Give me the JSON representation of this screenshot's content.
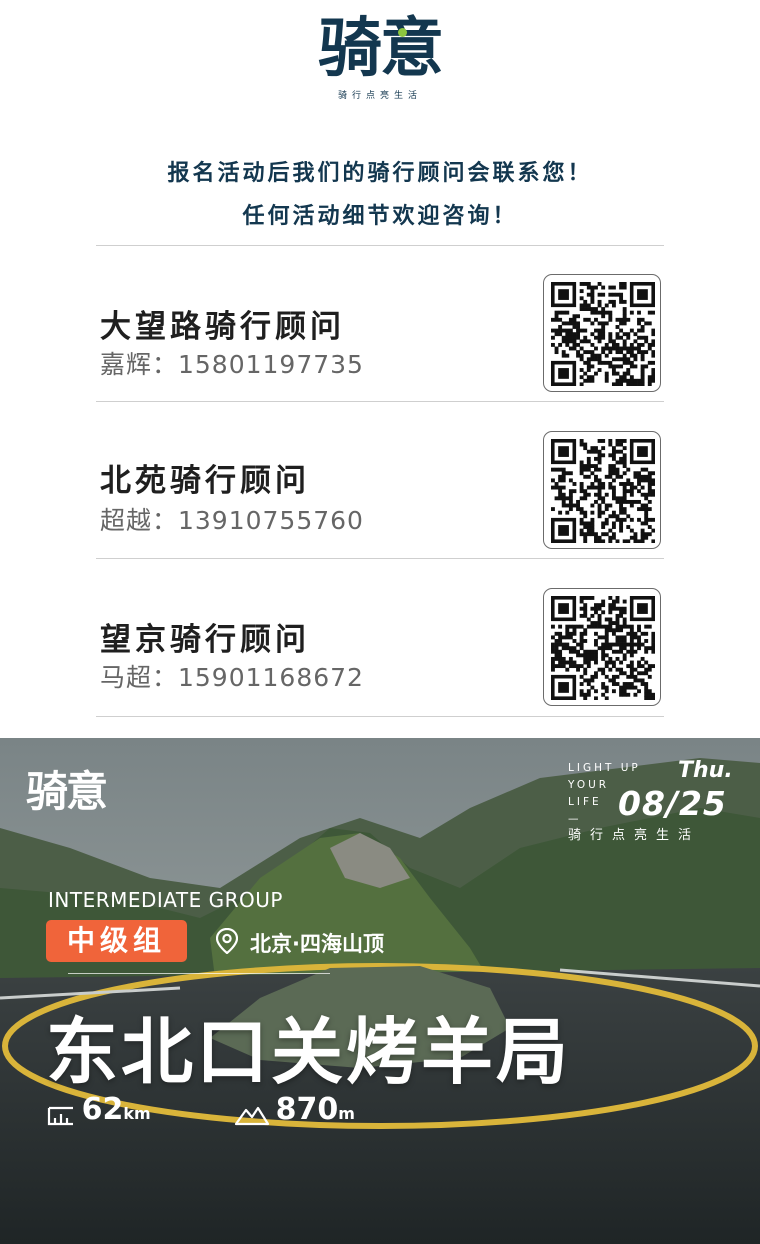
{
  "brand": {
    "logo_text": "骑意",
    "slogan": "骑行点亮生活"
  },
  "intro": {
    "line1": "报名活动后我们的骑行顾问会联系您！",
    "line2": "任何活动细节欢迎咨询！"
  },
  "advisors": [
    {
      "title": "大望路骑行顾问",
      "contact": "嘉辉：15801197735"
    },
    {
      "title": "北苑骑行顾问",
      "contact": "超越：13910755760"
    },
    {
      "title": "望京骑行顾问",
      "contact": "马超：15901168672"
    }
  ],
  "poster": {
    "logo_text": "骑意",
    "light_up": [
      "LIGHT UP",
      "YOUR",
      "LIFE",
      "—"
    ],
    "day_of_week": "Thu.",
    "date": "08/25",
    "slogan": "骑行点亮生活",
    "group_en": "INTERMEDIATE GROUP",
    "group_cn": "中级组",
    "location": "北京·四海山顶",
    "title": "东北口关烤羊局",
    "distance_value": "62",
    "distance_unit": "km",
    "elevation_value": "870",
    "elevation_unit": "m",
    "badge_color": "#f0643a"
  },
  "icons": {
    "qr": "qr-code-icon",
    "location": "location-pin-icon",
    "distance": "distance-icon",
    "elevation": "mountain-icon"
  }
}
